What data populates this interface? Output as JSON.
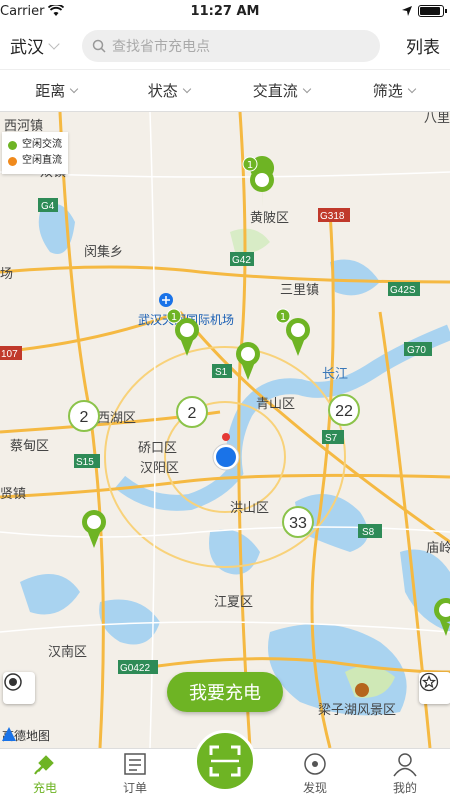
{
  "status": {
    "carrier": "Carrier",
    "time": "11:27 AM"
  },
  "header": {
    "city": "武汉",
    "search_placeholder": "查找省市充电点",
    "list_label": "列表"
  },
  "filters": [
    {
      "label": "距离"
    },
    {
      "label": "状态"
    },
    {
      "label": "交直流"
    },
    {
      "label": "筛选"
    }
  ],
  "legend": {
    "items": [
      {
        "label": "空闲交流",
        "color": "#6eb424"
      },
      {
        "label": "空闲直流",
        "color": "#f08a1c"
      }
    ]
  },
  "map": {
    "place_labels": [
      "西河镇",
      "双镇",
      "闵集乡",
      "场",
      "黄陂区",
      "三里镇",
      "武汉天河国际机场",
      "长江",
      "青山区",
      "硚口区",
      "汉阳区",
      "东西湖区",
      "蔡甸区",
      "洪山区",
      "江夏区",
      "汉南区",
      "梁子湖风景区",
      "八里",
      "贤镇",
      "庙岭"
    ],
    "road_labels": [
      "G4",
      "G42",
      "G318",
      "G42S",
      "S1",
      "G70",
      "S7",
      "S15",
      "S8",
      "G0422",
      "107"
    ],
    "clusters": [
      {
        "count": "2"
      },
      {
        "count": "2"
      },
      {
        "count": "22"
      },
      {
        "count": "33"
      }
    ],
    "pin_badges": [
      "1",
      "1",
      "1"
    ],
    "attribution": "高德地图"
  },
  "actions": {
    "charge_label": "我要充电"
  },
  "tabs": [
    {
      "label": "充电",
      "icon": "plug-icon"
    },
    {
      "label": "订单",
      "icon": "order-icon"
    },
    {
      "label": "",
      "icon": "scan-icon"
    },
    {
      "label": "发现",
      "icon": "discover-icon"
    },
    {
      "label": "我的",
      "icon": "user-icon"
    }
  ],
  "colors": {
    "accent": "#6eb424",
    "dc": "#f08a1c",
    "cluster_border": "#8bc34a"
  }
}
